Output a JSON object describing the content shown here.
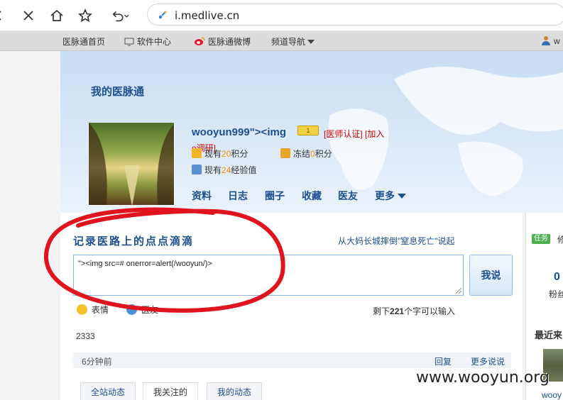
{
  "browser": {
    "url": "i.medlive.cn",
    "icons": [
      "close-icon",
      "home-icon",
      "star-icon",
      "undo-icon",
      "lock-icon"
    ]
  },
  "site_nav": {
    "home": "医脉通首页",
    "software": "软件中心",
    "weibo": "医脉通微博",
    "channels": "频道导航",
    "user_initial": "w"
  },
  "profile": {
    "section_title": "我的医脉通",
    "username": "wooyun999\"><img",
    "level": "1",
    "cert_line1": "[医师认证] [加入",
    "cert_line2": "e调研]",
    "points": {
      "prefix": "现有",
      "value": "20",
      "suffix": "积分"
    },
    "frozen": {
      "prefix": "冻结",
      "value": "0",
      "suffix": "积分"
    },
    "exp": {
      "prefix": "现有",
      "value": "24",
      "suffix": "经验值"
    },
    "tabs": [
      "资料",
      "日志",
      "圈子",
      "收藏",
      "医友",
      "更多"
    ]
  },
  "composer": {
    "title": "记录医路上的点点滴滴",
    "link": "从大妈长城摔倒\"窒息死亡\"说起",
    "text": "\"><img src=# onerror=alert(/wooyun/)>",
    "submit": "我说",
    "tool_emoji": "表情",
    "tool_friend": "医友",
    "remain_prefix": "剩下",
    "remain_count": "221",
    "remain_suffix": "个字可以输入"
  },
  "feed": {
    "text": "2333",
    "time": "6分钟前",
    "reply": "回复",
    "more": "更多说说",
    "tabs": [
      "全站动态",
      "我关注的",
      "我的动态"
    ]
  },
  "sidebar": {
    "task_badge": "任务",
    "task_text": "修",
    "count": "0",
    "fans_label": "粉丝",
    "recent_title": "最近来",
    "recent_user": "wooy"
  },
  "watermark": "www.wooyun.org",
  "colors": {
    "link_blue": "#1e4f8f",
    "accent_orange": "#f39200",
    "cert_red": "#cc0000",
    "annotation_red": "#e0141e"
  }
}
